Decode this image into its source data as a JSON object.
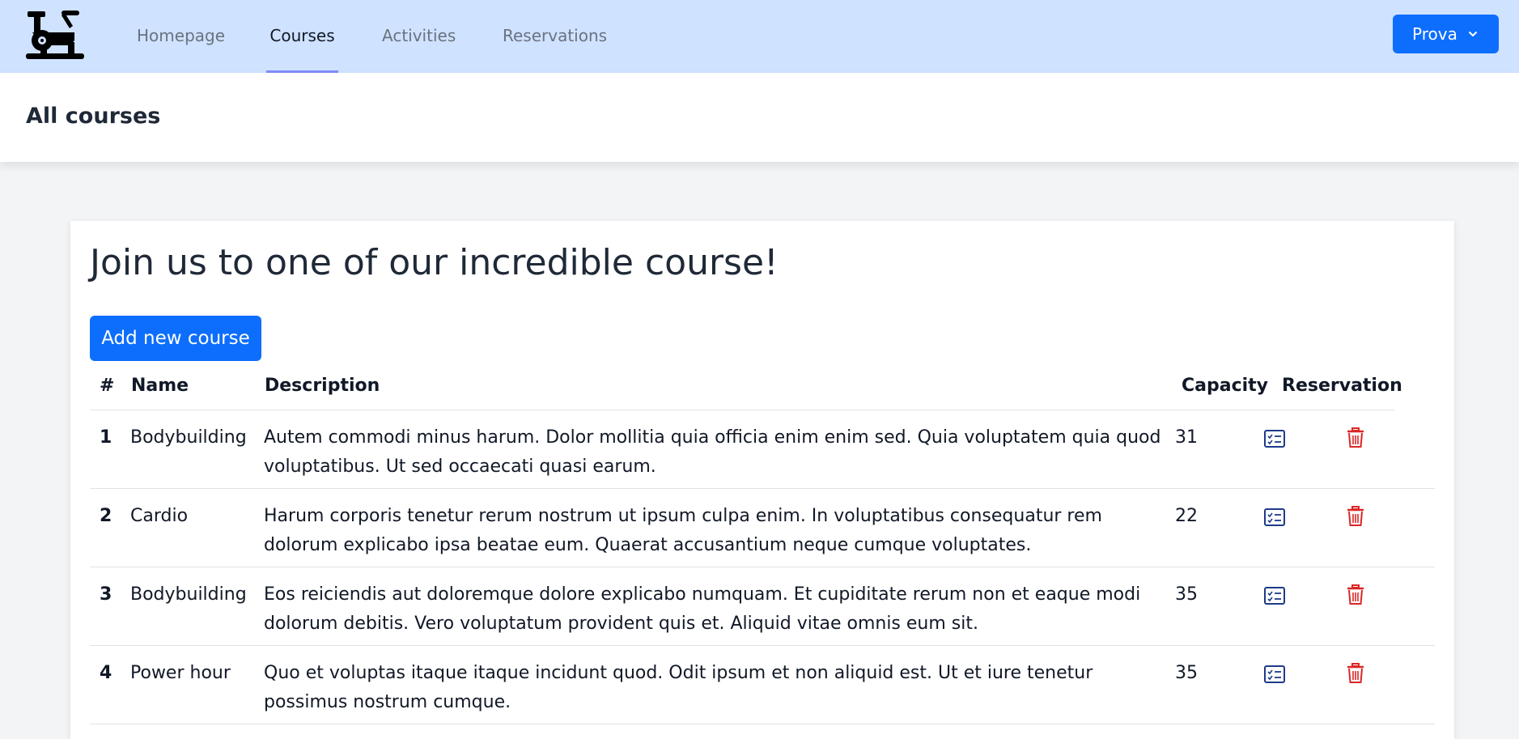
{
  "nav": {
    "items": [
      {
        "label": "Homepage"
      },
      {
        "label": "Courses"
      },
      {
        "label": "Activities"
      },
      {
        "label": "Reservations"
      }
    ],
    "active": "Courses",
    "user_label": "Prova"
  },
  "header": {
    "title": "All courses"
  },
  "main": {
    "heading": "Join us to one of our incredible course!",
    "add_button": "Add new course",
    "table": {
      "columns": [
        "#",
        "Name",
        "Description",
        "Capacity",
        "Reservation"
      ],
      "rows": [
        {
          "num": "1",
          "name": "Bodybuilding",
          "description": "Autem commodi minus harum. Dolor mollitia quia officia enim enim sed. Quia voluptatem quia quod voluptatibus. Ut sed occaecati quasi earum.",
          "capacity": "31"
        },
        {
          "num": "2",
          "name": "Cardio",
          "description": "Harum corporis tenetur rerum nostrum ut ipsum culpa enim. In voluptatibus consequatur rem dolorum explicabo ipsa beatae eum. Quaerat accusantium neque cumque voluptates.",
          "capacity": "22"
        },
        {
          "num": "3",
          "name": "Bodybuilding",
          "description": "Eos reiciendis aut doloremque dolore explicabo numquam. Et cupiditate rerum non et eaque modi dolorum debitis. Vero voluptatum provident quis et. Aliquid vitae omnis eum sit.",
          "capacity": "35"
        },
        {
          "num": "4",
          "name": "Power hour",
          "description": "Quo et voluptas itaque itaque incidunt quod. Odit ipsum et non aliquid est. Ut et iure tenetur possimus nostrum cumque.",
          "capacity": "35"
        }
      ]
    }
  },
  "icons": {
    "logo": "exercise-bike-icon",
    "dropdown": "chevron-down-icon",
    "reservation": "list-check-icon",
    "delete": "trash-icon"
  },
  "colors": {
    "navbar_bg": "#cfe2ff",
    "primary": "#0d6efd",
    "active_underline": "#818cf8",
    "reservation_icon": "#1e3a8a",
    "delete_icon": "#dc2626",
    "page_bg": "#f3f4f6"
  }
}
